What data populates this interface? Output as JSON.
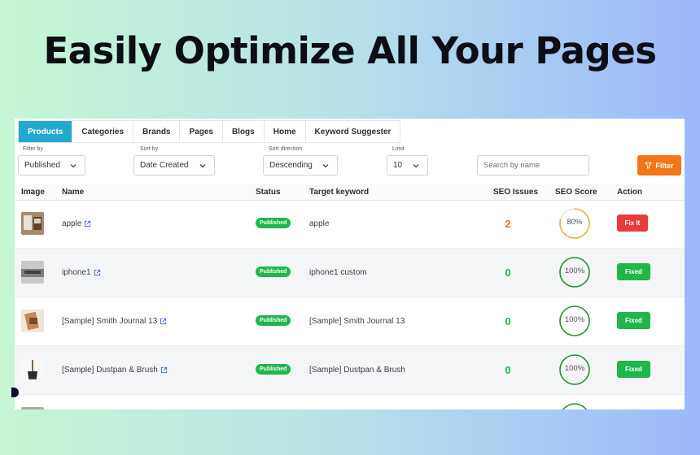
{
  "headline": "Easily Optimize All Your Pages",
  "tabs": [
    {
      "label": "Products",
      "active": true
    },
    {
      "label": "Categories"
    },
    {
      "label": "Brands"
    },
    {
      "label": "Pages"
    },
    {
      "label": "Blogs"
    },
    {
      "label": "Home"
    },
    {
      "label": "Keyword Suggester"
    }
  ],
  "filters": {
    "filter_by": {
      "label": "Filter by",
      "value": "Published"
    },
    "sort_by": {
      "label": "Sort by",
      "value": "Date Created"
    },
    "sort_direction": {
      "label": "Sort direction",
      "value": "Descending"
    },
    "limit": {
      "label": "Limit",
      "value": "10"
    },
    "search_placeholder": "Search by name",
    "filter_button": "Filter"
  },
  "table": {
    "headers": {
      "image": "Image",
      "name": "Name",
      "status": "Status",
      "target_keyword": "Target keyword",
      "seo_issues": "SEO Issues",
      "seo_score": "SEO Score",
      "action": "Action"
    },
    "rows": [
      {
        "name": "apple",
        "status": "Published",
        "keyword": "apple",
        "issues": "2",
        "score": "80%",
        "score_value": 80,
        "action": "Fix It",
        "action_type": "fix"
      },
      {
        "name": "iphone1",
        "status": "Published",
        "keyword": "iphone1 custom",
        "issues": "0",
        "score": "100%",
        "score_value": 100,
        "action": "Fixed",
        "action_type": "fixed"
      },
      {
        "name": "[Sample] Smith Journal 13",
        "status": "Published",
        "keyword": "[Sample] Smith Journal 13",
        "issues": "0",
        "score": "100%",
        "score_value": 100,
        "action": "Fixed",
        "action_type": "fixed"
      },
      {
        "name": "[Sample] Dustpan & Brush",
        "status": "Published",
        "keyword": "[Sample] Dustpan & Brush",
        "issues": "0",
        "score": "100%",
        "score_value": 100,
        "action": "Fixed",
        "action_type": "fixed"
      }
    ]
  },
  "colors": {
    "accent_tab": "#22a9cf",
    "filter_button": "#f5761a",
    "published_badge": "#1fb64b",
    "fix_button": "#ea3b3b",
    "issues_bad": "#f5761a",
    "issues_good": "#1fb64b",
    "score_good": "#1d9a2e",
    "score_warn": "#f2b134"
  }
}
